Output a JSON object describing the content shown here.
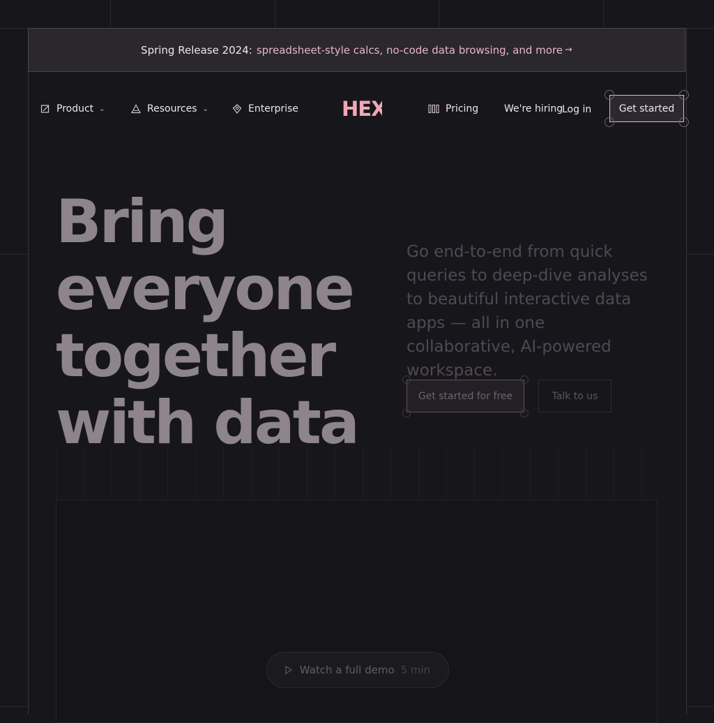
{
  "banner": {
    "prefix": "Spring Release 2024:",
    "link": "spreadsheet-style calcs, no-code data browsing, and more",
    "arrow": "→"
  },
  "nav": {
    "product": "Product",
    "resources": "Resources",
    "enterprise": "Enterprise",
    "logo_text": "HEX",
    "pricing": "Pricing",
    "hiring": "We're hiring",
    "login": "Log in",
    "get_started": "Get started"
  },
  "hero": {
    "title_lines": [
      "Bring",
      "everyone",
      "together",
      "with data"
    ],
    "subtitle": "Go end-to-end from quick queries to deep-dive analyses to beautiful interactive data apps — all in one collaborative, AI-powered workspace.",
    "cta_primary": "Get started for free",
    "cta_secondary": "Talk to us"
  },
  "demo": {
    "label": "Watch a full demo",
    "duration": "5 min"
  },
  "colors": {
    "background": "#17161b",
    "accent_pink": "#e7b8c3",
    "banner_bg": "#2a272d"
  },
  "icons": {
    "product": "notebook-pen-icon",
    "resources": "triangle-icon",
    "enterprise": "diamond-pin-icon",
    "pricing": "columns-icon",
    "demo": "play-icon"
  }
}
